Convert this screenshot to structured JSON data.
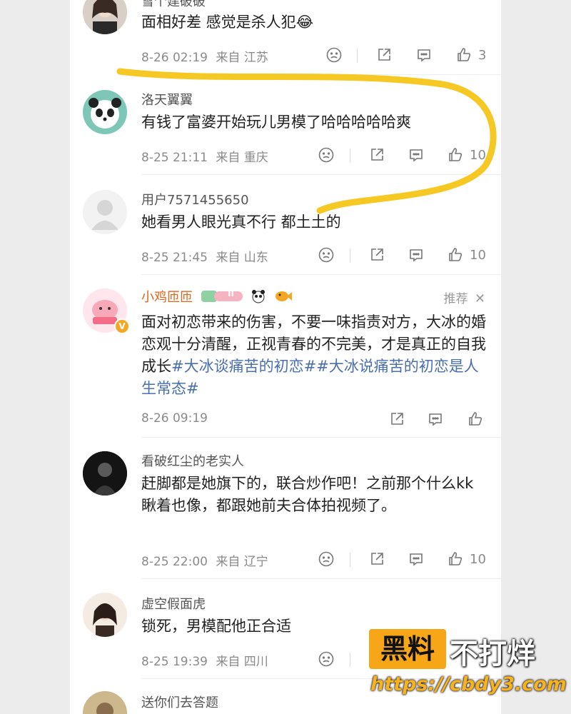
{
  "comments": [
    {
      "name": "雪个建破破",
      "text": "面相好差 感觉是杀人犯😂",
      "time": "8-26 02:19",
      "location": "来自 江苏",
      "likes": "3"
    },
    {
      "name": "洛天翼翼",
      "text": "有钱了富婆开始玩儿男模了哈哈哈哈哈爽",
      "time": "8-25 21:11",
      "location": "来自 重庆",
      "likes": "10"
    },
    {
      "name": "用户7571455650",
      "text": "她看男人眼光真不行 都土土的",
      "time": "8-25 21:45",
      "location": "来自 山东",
      "likes": "10"
    },
    {
      "name": "小鸡匝匝",
      "text_plain": "面对初恋带来的伤害，不要一味指责对方，大冰的婚恋观十分清醒，正视青春的不完美，才是真正的自我成长",
      "tag1": "#大冰谈痛苦的初恋#",
      "tag2": "#大冰说痛苦的初恋是人生常态#",
      "time": "8-26 09:19",
      "recommend": "推荐",
      "badge_level": "II"
    },
    {
      "name": "看破红尘的老实人",
      "text": "赶脚都是她旗下的，联合炒作吧！之前那个什么kk瞅着也像，都跟她前夫合体拍视频了。",
      "time": "8-25 22:00",
      "location": "来自 辽宁",
      "likes": "10"
    },
    {
      "name": "虚空假面虎",
      "text": "锁死，男模配他正合适",
      "time": "8-25 19:39",
      "location": "来自 四川"
    },
    {
      "name": "送你们去答题"
    }
  ],
  "watermark": {
    "box": "黑料",
    "title": "不打烊",
    "url": "https://cbdy3.com"
  },
  "colors": {
    "highlight": "#f5c518",
    "tag": "#4a6fae",
    "vip_name": "#e0651a"
  }
}
